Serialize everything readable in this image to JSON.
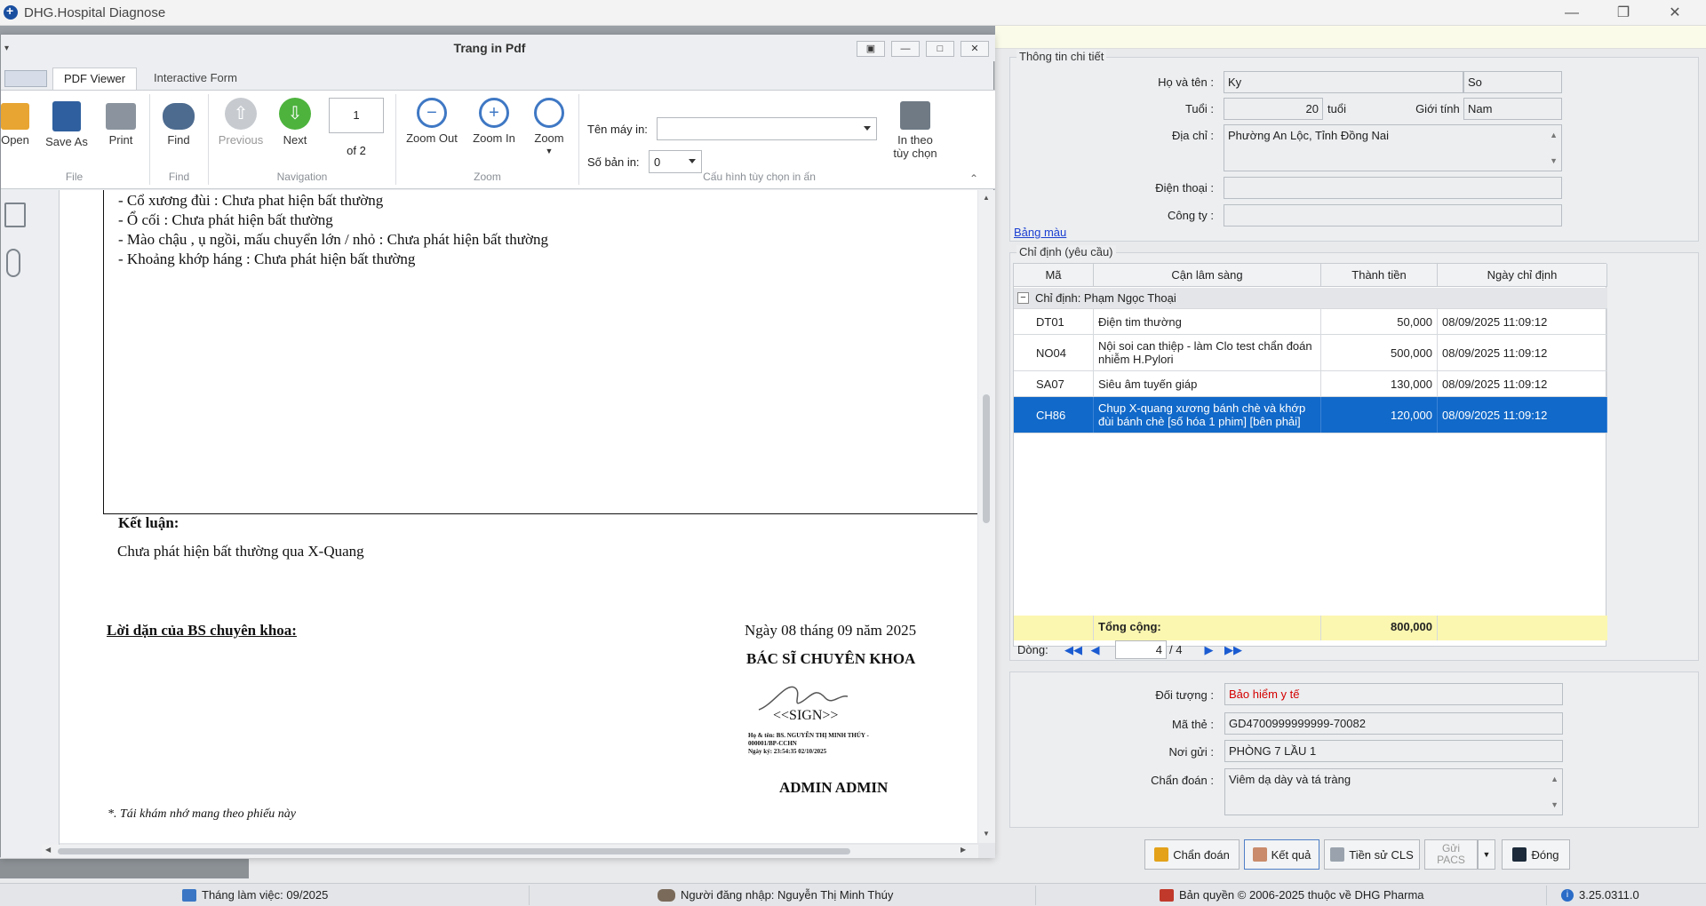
{
  "app": {
    "title": "DHG.Hospital Diagnose"
  },
  "patient_panel": {
    "group_title": "Thông tin chi tiết",
    "name_label": "Họ và tên :",
    "name_value": "Ky",
    "name_value2": "So",
    "age_label": "Tuổi :",
    "age_value": "20",
    "age_unit": "tuổi",
    "gender_label": "Giới tính :",
    "gender_value": "Nam",
    "address_label": "Địa chỉ :",
    "address_value": "Phường An Lộc, Tỉnh Đồng Nai",
    "phone_label": "Điện thoại :",
    "phone_value": "",
    "company_label": "Công ty :",
    "company_value": ""
  },
  "color_table_link": "Bảng màu",
  "orders": {
    "group_title": "Chỉ định (yêu cầu)",
    "columns": [
      "Mã",
      "Cận lâm sàng",
      "Thành tiền",
      "Ngày chỉ định"
    ],
    "group_row": "Chỉ định:  Phạm Ngọc Thoại",
    "rows": [
      {
        "code": "DT01",
        "name": "Điện tim thường",
        "amount": "50,000",
        "date": "08/09/2025 11:09:12"
      },
      {
        "code": "NO04",
        "name": "Nội soi can thiệp - làm Clo test chẩn đoán nhiễm H.Pylori",
        "amount": "500,000",
        "date": "08/09/2025 11:09:12"
      },
      {
        "code": "SA07",
        "name": "Siêu âm tuyến giáp",
        "amount": "130,000",
        "date": "08/09/2025 11:09:12"
      },
      {
        "code": "CH86",
        "name": "Chụp X-quang xương bánh chè và khớp đùi bánh chè [số hóa 1 phim] [bên phải]",
        "amount": "120,000",
        "date": "08/09/2025 11:09:12"
      }
    ],
    "total_label": "Tổng cộng:",
    "total_value": "800,000",
    "nav_label": "Dòng:",
    "nav_current": "4",
    "nav_total": "/  4"
  },
  "insurance": {
    "subject_label": "Đối tượng :",
    "subject_value": "Bảo hiểm y tế",
    "card_label": "Mã thẻ :",
    "card_value": "GD4700999999999-70082",
    "sender_label": "Nơi gửi :",
    "sender_value": "PHÒNG 7 LẦU 1",
    "diagnosis_label": "Chẩn đoán :",
    "diagnosis_value": "Viêm dạ dày và tá tràng"
  },
  "buttons": {
    "diagnose": "Chẩn đoán",
    "result": "Kết quả",
    "history": "Tiền sử CLS",
    "pacs_line1": "Gửi",
    "pacs_line2": "PACS",
    "close": "Đóng"
  },
  "status_bar": {
    "month": "Tháng làm việc: 09/2025",
    "user": "Người đăng nhập: Nguyễn Thị Minh Thúy",
    "copyright": "Bản quyền © 2006-2025 thuộc về DHG Pharma",
    "version": "3.25.0311.0"
  },
  "pdf_window": {
    "title": "Trang in Pdf",
    "tabs": [
      "PDF Viewer",
      "Interactive Form"
    ],
    "ribbon": {
      "open": "Open",
      "save_as": "Save As",
      "print": "Print",
      "find": "Find",
      "previous": "Previous",
      "next": "Next",
      "page_value": "1",
      "of_pages": "of 2",
      "zoom_out": "Zoom Out",
      "zoom_in": "Zoom In",
      "zoom": "Zoom",
      "printer_label": "Tên máy in:",
      "printer_value": "",
      "copies_label": "Số bản in:",
      "copies_value": "0",
      "custom_print_line1": "In theo",
      "custom_print_line2": "tùy chọn",
      "groups": {
        "file": "File",
        "find": "Find",
        "navigation": "Navigation",
        "zoom": "Zoom",
        "print_config": "Cấu hình tùy chọn in ấn"
      }
    },
    "document": {
      "findings": [
        "- Cổ xương đùi : Chưa phat hiện bất thường",
        "- Ổ cối : Chưa phát hiện bất thường",
        "- Mào chậu , ụ ngồi, mấu chuyển lớn / nhỏ : Chưa phát hiện bất thường",
        "- Khoảng khớp háng : Chưa phát hiện bất thường"
      ],
      "conclusion_title": "Kết luận:",
      "conclusion_text": "Chưa phát hiện bất thường qua X-Quang",
      "advice_title": "Lời dặn của BS chuyên khoa:",
      "date_line": "Ngày 08 tháng 09 năm 2025",
      "doctor_title": "BÁC SĨ CHUYÊN KHOA",
      "sign_placeholder": "<<SIGN>>",
      "sign_detail1": "Họ & tên:    BS. NGUYỄN THỊ MINH THÚY -",
      "sign_detail2": "000001/BP-CCHN",
      "sign_detail3": "Ngày ký:      23:54:35 02/10/2025",
      "signer_name": "ADMIN ADMIN",
      "footnote": "*. Tái khám nhớ mang theo phiếu này"
    }
  }
}
